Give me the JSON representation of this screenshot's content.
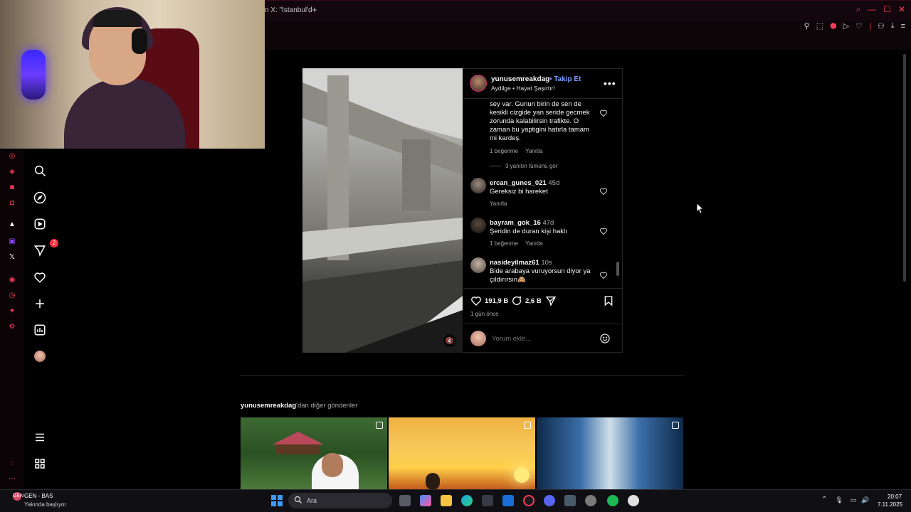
{
  "browser": {
    "tab_fragment": "n X: \"İstanbul'd",
    "new_tab_symbol": "+",
    "window_controls": [
      "⌕",
      "—",
      "☐",
      "✕"
    ],
    "toolbar_icons": [
      "pin-icon",
      "snapshot-icon",
      "shield-icon",
      "play-icon",
      "heart-icon",
      "account-icon",
      "download-icon",
      "menu-icon"
    ]
  },
  "ig_nav": {
    "notification_count": "2"
  },
  "post": {
    "author": "yunusemreakdag",
    "follow_label": "• Takip Et",
    "audio": "Aydilge • Hayat Şaşırtır!",
    "more_symbol": "•••",
    "comments": [
      {
        "text": "sey var. Gunun birin de sen de kesikli cizgide yan seride gecmek zorunda kalabilirsin trafikte. O zaman bu yaptigini hatırla tamam mi kardeş.",
        "likes": "1 beğenme",
        "reply": "Yanıtla"
      },
      {
        "user": "ercan_gunes_021",
        "time": "45d",
        "text": "Gereksiz bi hareket",
        "reply": "Yanıtla"
      },
      {
        "user": "bayram_gok_16",
        "time": "47d",
        "text": "Şeridin de duran kişi haklı",
        "likes": "1 beğenme",
        "reply": "Yanıtla"
      },
      {
        "user": "nasideyilmaz61",
        "time": "10s",
        "text": "Bide arabaya vuruyorsun diyor ya çıldırırsın🙈"
      }
    ],
    "view_replies": "3 yanıtın tümünü gör",
    "like_count": "191,9 B",
    "comment_count": "2,6 B",
    "date": "1 gün önce",
    "comment_placeholder": "Yorum ekle..."
  },
  "more_posts": {
    "username": "yunusemreakdag",
    "suffix": "'dan diğer gönderiler"
  },
  "taskbar": {
    "weather_badge": "GEN",
    "weather_title": "GEN - BAS",
    "weather_sub": "Yakında başlıyor",
    "search_placeholder": "Ara",
    "tray_up": "⌃",
    "time": "20:07",
    "date": "7.11.2025"
  },
  "colors": {
    "accent": "#ff3b5c",
    "link": "#7a9cff",
    "muted": "#a8a8a8"
  }
}
